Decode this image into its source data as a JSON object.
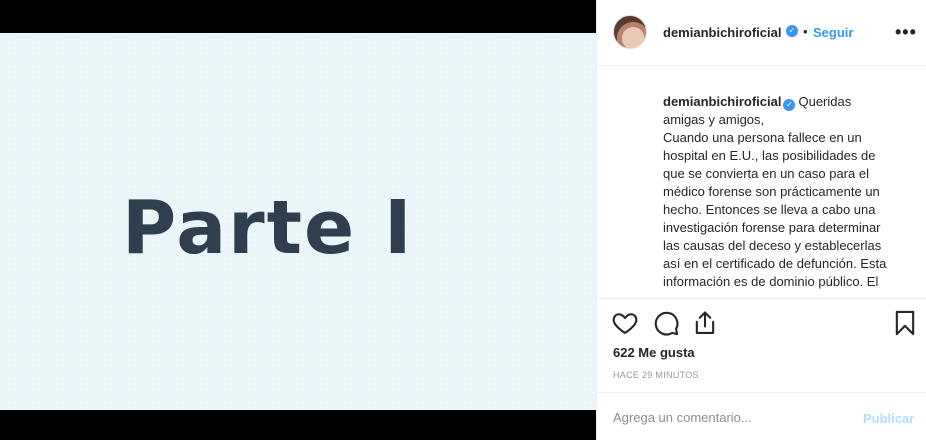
{
  "post": {
    "media_text": "Parte I"
  },
  "header": {
    "username": "demianbichiroficial",
    "separator": "•",
    "follow_label": "Seguir",
    "more_label": "•••"
  },
  "caption": {
    "username": "demianbichiroficial",
    "lines": [
      "Queridas",
      "amigas y amigos,",
      "Cuando una persona fallece en un",
      "hospital en E.U., las posibilidades de",
      "que se convierta en un caso para el",
      "médico forense son prácticamente un",
      "hecho. Entonces se lleva a cabo una",
      "investigación forense para determinar",
      "las causas del deceso y establecerlas",
      "así en el certificado de defunción. Esta",
      "información es de dominio público. El"
    ]
  },
  "actions": {
    "like_icon": "heart-icon",
    "comment_icon": "comment-icon",
    "share_icon": "share-icon",
    "save_icon": "bookmark-icon"
  },
  "stats": {
    "likes": "622 Me gusta",
    "timestamp": "HACE 29 MINUTOS"
  },
  "comment": {
    "placeholder": "Agrega un comentario...",
    "publish_label": "Publicar"
  },
  "colors": {
    "accent": "#3897f0",
    "publish_disabled": "#b2dffc",
    "media_bg": "#e9f5f8",
    "media_text": "#2f3f4f"
  }
}
